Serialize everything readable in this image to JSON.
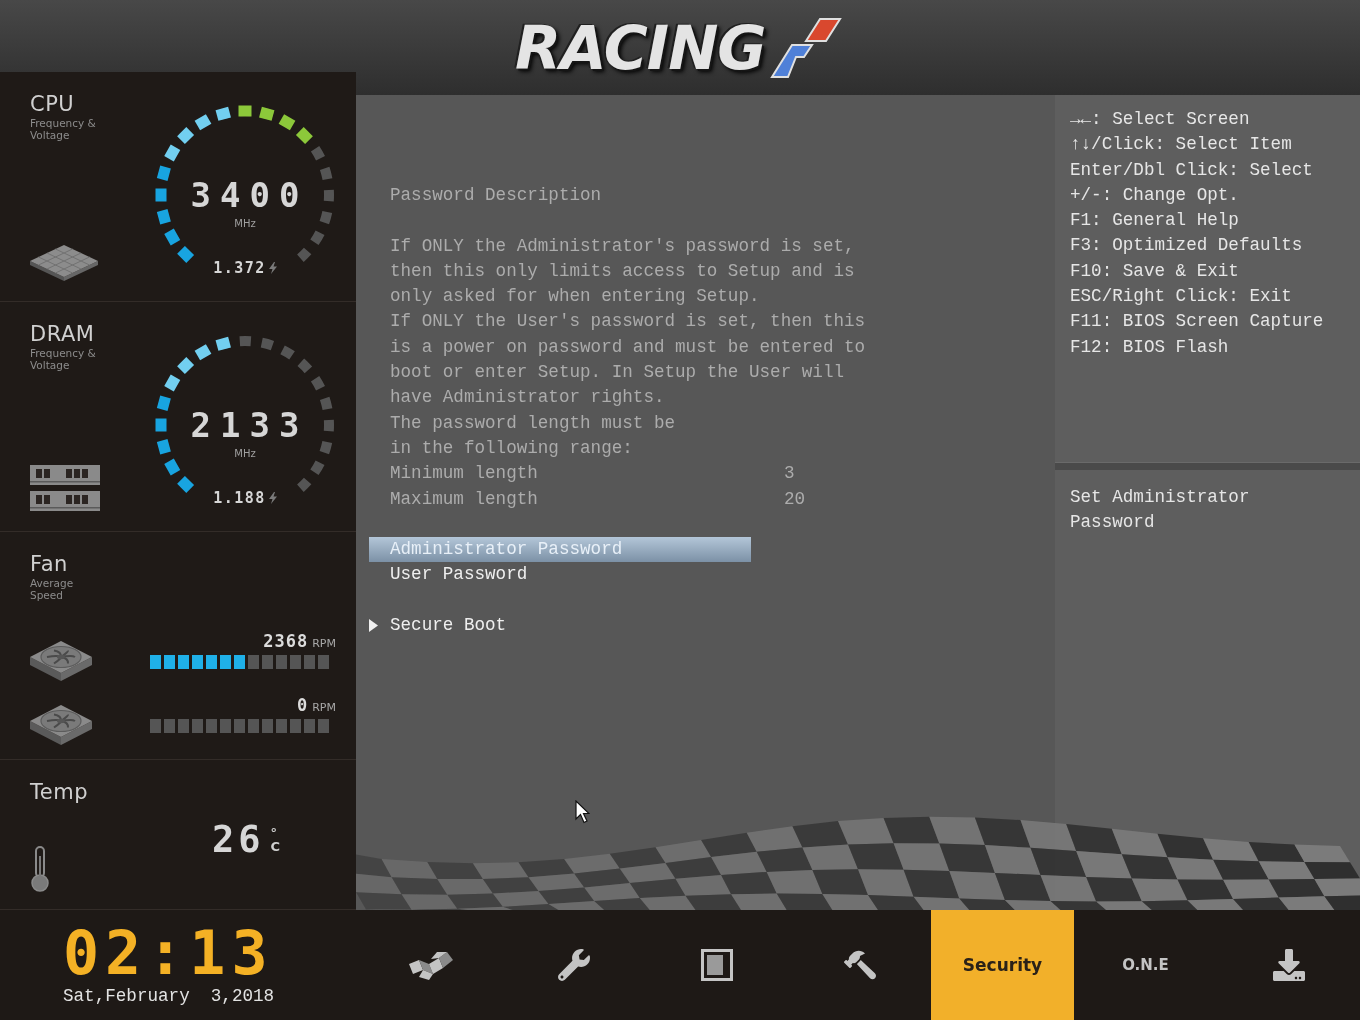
{
  "header": {
    "logo": "RACING"
  },
  "sidebar": {
    "sections": [
      {
        "kind": "cpu",
        "title": "CPU",
        "subtitle": "Frequency & Voltage",
        "gauge": {
          "value": "3400",
          "unit": "MHz",
          "voltage": "1.372",
          "level": 0.68
        }
      },
      {
        "kind": "memory",
        "title": "DRAM",
        "subtitle": "Frequency & Voltage",
        "gauge": {
          "value": "2133",
          "unit": "MHz",
          "voltage": "1.188",
          "level": 0.47
        }
      },
      {
        "kind": "fan",
        "title": "Fan",
        "subtitle": "Average Speed",
        "fans": [
          {
            "reading": "2368",
            "unit": "RPM",
            "level": 0.54
          },
          {
            "reading": "0",
            "unit": "RPM"
          }
        ]
      },
      {
        "kind": "temperature",
        "title": "Temp",
        "reading": "26",
        "unit": "°C"
      }
    ]
  },
  "settings": {
    "heading": "Password Description",
    "paragraphs": [
      "If ONLY the Administrator's password is set,\nthen this only limits access to Setup and is\nonly asked for when entering Setup.",
      "If ONLY the User's password is set, then this\nis a power on password and must be entered to\nboot or enter Setup. In Setup the User will\nhave Administrator rights.",
      "The password length must be\nin the following range:"
    ],
    "ranges": [
      {
        "label": "Minimum length",
        "value": "3"
      },
      {
        "label": "Maximum length",
        "value": "20"
      }
    ],
    "items": [
      {
        "kind": "item",
        "label": "Administrator Password",
        "selected": true
      },
      {
        "kind": "item",
        "label": "User Password",
        "selected": false
      },
      {
        "kind": "submenu",
        "label": "Secure Boot",
        "selected": false
      }
    ]
  },
  "help": {
    "keys": [
      "→←: Select Screen",
      "↑↓/Click: Select Item",
      "Enter/Dbl Click: Select",
      "+/-: Change Opt.",
      "F1: General Help",
      "F3: Optimized Defaults",
      "F10: Save & Exit",
      "ESC/Right Click: Exit",
      "F11: BIOS Screen Capture",
      "F12: BIOS Flash"
    ],
    "item_help": "Set Administrator Password"
  },
  "footer": {
    "time": "02:13",
    "date": "Sat,February  3,2018",
    "tabs": [
      {
        "kind": "icon",
        "selected": false
      },
      {
        "kind": "icon",
        "selected": false
      },
      {
        "kind": "icon",
        "selected": false
      },
      {
        "kind": "icon",
        "selected": false
      },
      {
        "kind": "text",
        "label": "Security",
        "selected": true
      },
      {
        "kind": "text",
        "label": "O.N.E",
        "selected": false
      },
      {
        "kind": "icon",
        "selected": false
      }
    ]
  }
}
